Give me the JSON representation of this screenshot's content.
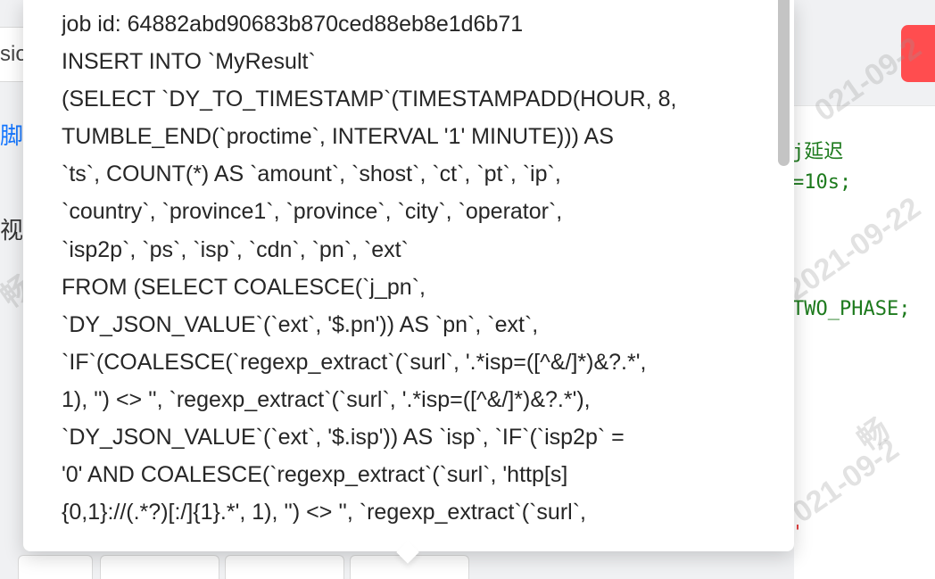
{
  "background": {
    "input_fragment": "sio",
    "link_fragment": "脚",
    "text_fragment": "视",
    "code_lines": [
      "j延迟",
      "=10s;",
      "TWO_PHASE;"
    ],
    "code_red": "'",
    "watermark_texts": [
      "021-09-2",
      "2021-09-22",
      "021-09-2",
      "畅",
      "畅"
    ],
    "colors": {
      "danger": "#ff4d4f",
      "code_green": "#1d7a1d",
      "link": "#1677ff"
    }
  },
  "popover": {
    "lines": [
      "job id: 64882abd90683b870ced88eb8e1d6b71",
      "INSERT INTO `MyResult`",
      "(SELECT `DY_TO_TIMESTAMP`(TIMESTAMPADD(HOUR, 8,",
      "TUMBLE_END(`proctime`, INTERVAL '1' MINUTE))) AS",
      "`ts`, COUNT(*) AS `amount`, `shost`, `ct`, `pt`, `ip`,",
      "`country`, `province1`, `province`, `city`, `operator`,",
      "`isp2p`, `ps`, `isp`, `cdn`, `pn`, `ext`",
      "FROM (SELECT COALESCE(`j_pn`,",
      "`DY_JSON_VALUE`(`ext`, '$.pn')) AS `pn`, `ext`,",
      "`IF`(COALESCE(`regexp_extract`(`surl`, '.*isp=([^&/]*)&?.*',",
      "1), '') <> '', `regexp_extract`(`surl`, '.*isp=([^&/]*)&?.*'),",
      "`DY_JSON_VALUE`(`ext`, '$.isp')) AS `isp`, `IF`(`isp2p` =",
      "'0' AND COALESCE(`regexp_extract`(`surl`, 'http[s]",
      "{0,1}://(.*?)[:/]{1}.*', 1), '') <> '', `regexp_extract`(`surl`,"
    ]
  }
}
